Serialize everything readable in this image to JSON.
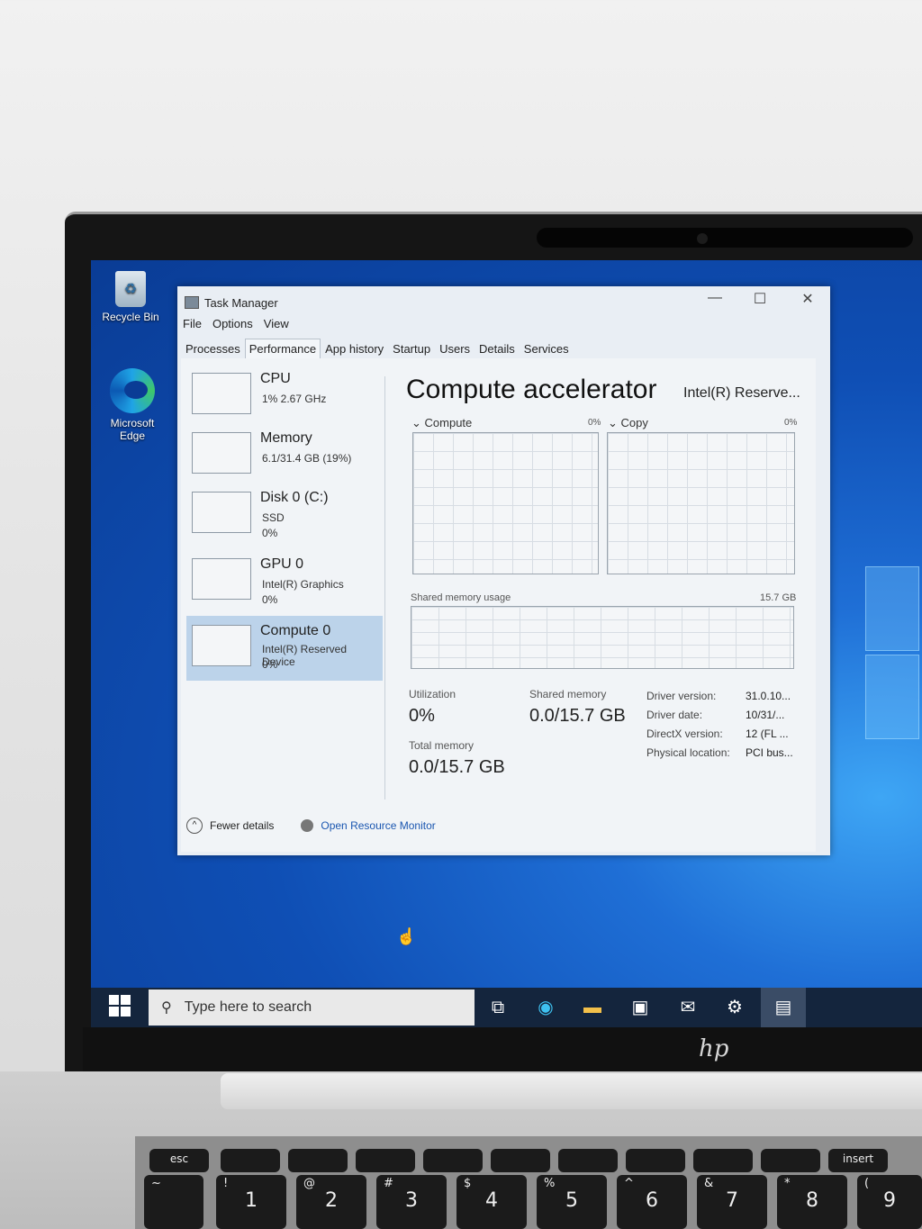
{
  "desktop": {
    "icons": [
      {
        "label": "Recycle Bin"
      },
      {
        "label": "Microsoft Edge"
      }
    ]
  },
  "task_manager": {
    "title": "Task Manager",
    "window_controls": {
      "minimize": "—",
      "maximize": "☐",
      "close": "✕"
    },
    "menu": [
      "File",
      "Options",
      "View"
    ],
    "tabs": [
      "Processes",
      "Performance",
      "App history",
      "Startup",
      "Users",
      "Details",
      "Services"
    ],
    "active_tab": "Performance",
    "sidebar": [
      {
        "name": "CPU",
        "line1": "1% 2.67 GHz",
        "line2": ""
      },
      {
        "name": "Memory",
        "line1": "6.1/31.4 GB (19%)",
        "line2": ""
      },
      {
        "name": "Disk 0 (C:)",
        "line1": "SSD",
        "line2": "0%"
      },
      {
        "name": "GPU 0",
        "line1": "Intel(R) Graphics",
        "line2": "0%"
      },
      {
        "name": "Compute 0",
        "line1": "Intel(R) Reserved Device",
        "line2": "0%"
      }
    ],
    "selected_item": "Compute 0",
    "main": {
      "title": "Compute accelerator",
      "device": "Intel(R) Reserve...",
      "graph1": {
        "label": "Compute",
        "pct": "0%"
      },
      "graph2": {
        "label": "Copy",
        "pct": "0%"
      },
      "shared_graph": {
        "label": "Shared memory usage",
        "max": "15.7 GB"
      },
      "utilization": {
        "label": "Utilization",
        "value": "0%"
      },
      "shared_memory": {
        "label": "Shared memory",
        "value": "0.0/15.7 GB"
      },
      "total_memory": {
        "label": "Total memory",
        "value": "0.0/15.7 GB"
      },
      "details": [
        {
          "key": "Driver version:",
          "value": "31.0.10..."
        },
        {
          "key": "Driver date:",
          "value": "10/31/..."
        },
        {
          "key": "DirectX version:",
          "value": "12 (FL ..."
        },
        {
          "key": "Physical location:",
          "value": "PCI bus..."
        }
      ]
    },
    "footer": {
      "fewer_details": "Fewer details",
      "resource_monitor": "Open Resource Monitor"
    }
  },
  "taskbar": {
    "search_placeholder": "Type here to search",
    "icons": [
      "task-view-icon",
      "edge-icon",
      "file-explorer-icon",
      "store-icon",
      "mail-icon",
      "settings-icon",
      "task-manager-icon"
    ]
  },
  "laptop": {
    "brand_logo": "hp"
  },
  "keyboard": {
    "fn_row": [
      "esc",
      "",
      "",
      "",
      "",
      "",
      "",
      "",
      "",
      "",
      "insert"
    ],
    "num_row": [
      {
        "main": "",
        "sub": "~"
      },
      {
        "main": "1",
        "sub": "!"
      },
      {
        "main": "2",
        "sub": "@"
      },
      {
        "main": "3",
        "sub": "#"
      },
      {
        "main": "4",
        "sub": "$"
      },
      {
        "main": "5",
        "sub": "%"
      },
      {
        "main": "6",
        "sub": "^"
      },
      {
        "main": "7",
        "sub": "&"
      },
      {
        "main": "8",
        "sub": "*"
      },
      {
        "main": "9",
        "sub": "("
      }
    ]
  }
}
